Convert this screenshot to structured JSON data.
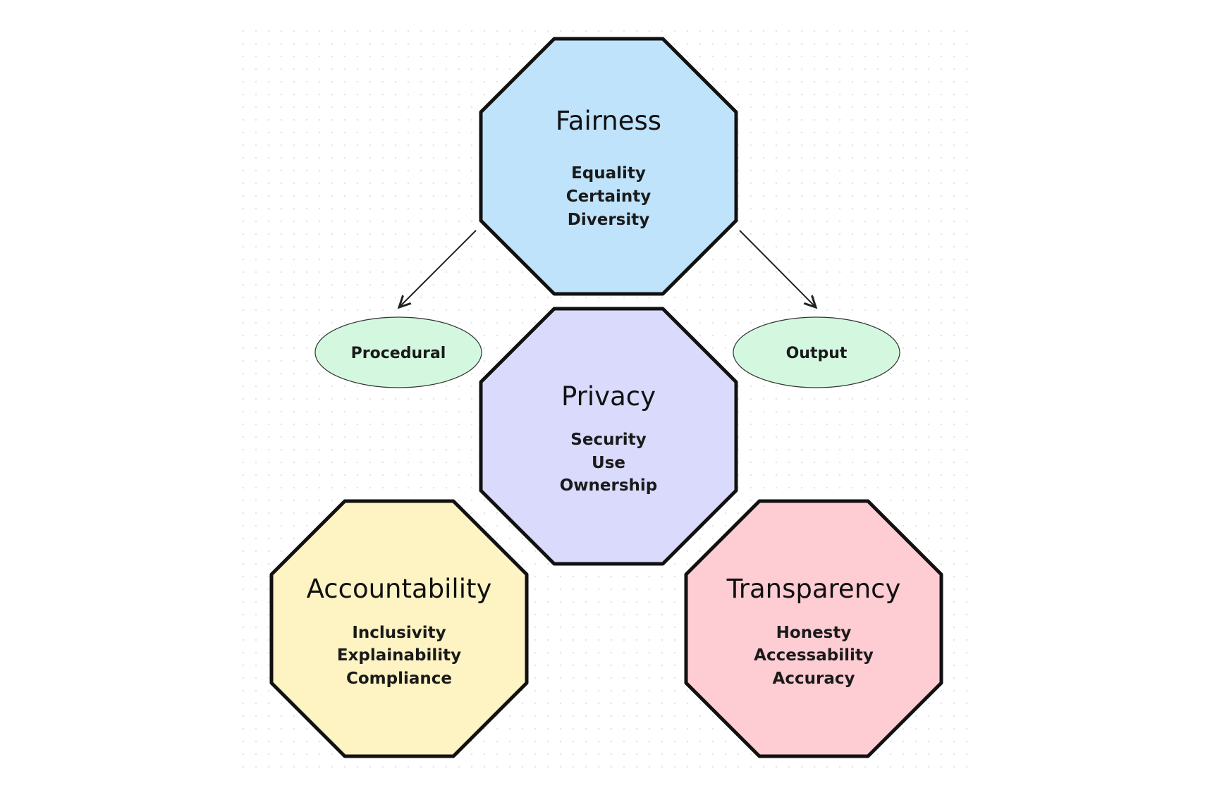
{
  "nodes": {
    "fairness": {
      "title": "Fairness",
      "items": [
        "Equality",
        "Certainty",
        "Diversity"
      ],
      "color": "#bfe3fb"
    },
    "privacy": {
      "title": "Privacy",
      "items": [
        "Security",
        "Use",
        "Ownership"
      ],
      "color": "#d9dafc"
    },
    "accountability": {
      "title": "Accountability",
      "items": [
        "Inclusivity",
        "Explainability",
        "Compliance"
      ],
      "color": "#fdf3c3"
    },
    "transparency": {
      "title": "Transparency",
      "items": [
        "Honesty",
        "Accessability",
        "Accuracy"
      ],
      "color": "#fecdd3"
    }
  },
  "branches": {
    "procedural": {
      "label": "Procedural",
      "color": "#d4f8df"
    },
    "output": {
      "label": "Output",
      "color": "#d4f8df"
    }
  },
  "edges": [
    {
      "from": "Fairness",
      "to": "Procedural"
    },
    {
      "from": "Fairness",
      "to": "Output"
    }
  ]
}
